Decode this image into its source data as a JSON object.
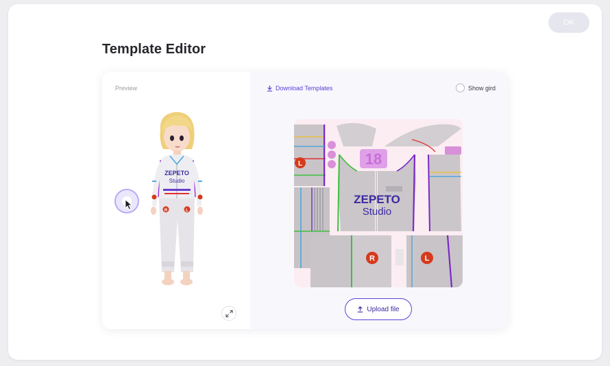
{
  "header": {
    "ok_label": "OK",
    "title": "Template Editor"
  },
  "preview": {
    "label": "Preview",
    "avatar_logo_line1": "ZEPETO",
    "avatar_logo_line2": "Studio",
    "badge_right": "R",
    "badge_left": "L"
  },
  "editor": {
    "download_label": "Download Templates",
    "show_grid_label": "Show gird",
    "show_grid_checked": false,
    "texture_logo_line1": "ZEPETO",
    "texture_logo_line2": "Studio",
    "texture_number": "18",
    "badge_right": "R",
    "badge_left": "L",
    "upload_label": "Upload file"
  },
  "colors": {
    "accent": "#5b3fd6",
    "logo": "#3b2aa0",
    "badge_red": "#d63a1c",
    "seam_green": "#3cc03c",
    "seam_purple": "#7a28c8",
    "seam_blue": "#3aa0e0",
    "seam_yellow": "#e8c040",
    "seam_red": "#e03030",
    "pink_patch": "#d890d8"
  }
}
